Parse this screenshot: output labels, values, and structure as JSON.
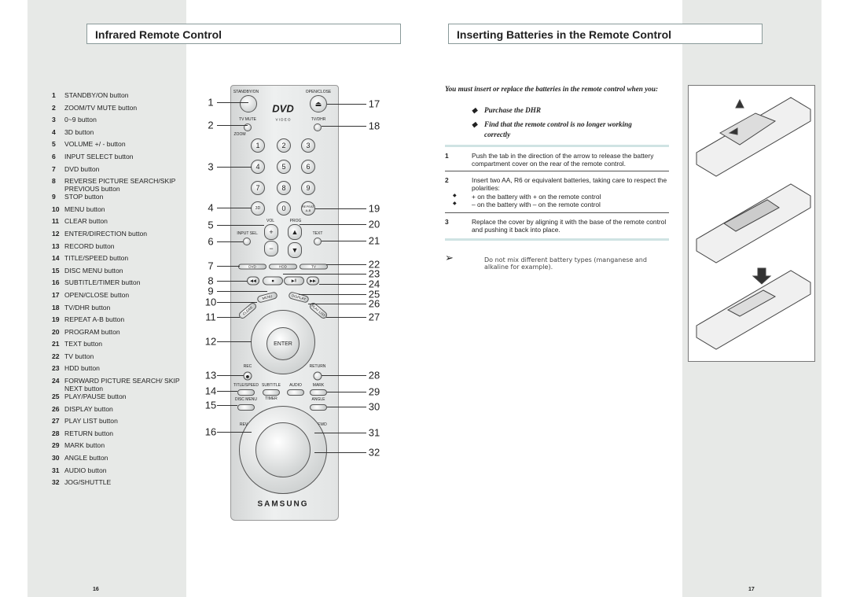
{
  "left_page": {
    "title": "Infrared Remote Control",
    "page_number": "16",
    "items": [
      {
        "n": "1",
        "t": "STANDBY/ON button"
      },
      {
        "n": "2",
        "t": "ZOOM/TV MUTE button"
      },
      {
        "n": "3",
        "t": "0~9 button"
      },
      {
        "n": "4",
        "t": "3D button"
      },
      {
        "n": "5",
        "t": "VOLUME +/ - button"
      },
      {
        "n": "6",
        "t": "INPUT SELECT button"
      },
      {
        "n": "7",
        "t": "DVD button"
      },
      {
        "n": "8",
        "t": "REVERSE PICTURE SEARCH/SKIP PREVIOUS button"
      },
      {
        "n": "9",
        "t": "STOP button"
      },
      {
        "n": "10",
        "t": "MENU button"
      },
      {
        "n": "11",
        "t": "CLEAR button"
      },
      {
        "n": "12",
        "t": "ENTER/DIRECTION button"
      },
      {
        "n": "13",
        "t": "RECORD button"
      },
      {
        "n": "14",
        "t": "TITLE/SPEED button"
      },
      {
        "n": "15",
        "t": "DISC MENU button"
      },
      {
        "n": "16",
        "t": "SUBTITLE/TIMER button"
      },
      {
        "n": "17",
        "t": "OPEN/CLOSE button"
      },
      {
        "n": "18",
        "t": "TV/DHR button"
      },
      {
        "n": "19",
        "t": "REPEAT A-B button"
      },
      {
        "n": "20",
        "t": "PROGRAM button"
      },
      {
        "n": "21",
        "t": "TEXT button"
      },
      {
        "n": "22",
        "t": "TV button"
      },
      {
        "n": "23",
        "t": "HDD button"
      },
      {
        "n": "24",
        "t": "FORWARD PICTURE SEARCH/ SKIP NEXT button"
      },
      {
        "n": "25",
        "t": "PLAY/PAUSE button"
      },
      {
        "n": "26",
        "t": "DISPLAY button"
      },
      {
        "n": "27",
        "t": "PLAY LIST button"
      },
      {
        "n": "28",
        "t": "RETURN button"
      },
      {
        "n": "29",
        "t": "MARK button"
      },
      {
        "n": "30",
        "t": "ANGLE button"
      },
      {
        "n": "31",
        "t": "AUDIO button"
      },
      {
        "n": "32",
        "t": "JOG/SHUTTLE"
      }
    ]
  },
  "remote": {
    "standby": "STANDBY/ON",
    "open_close": "OPEN/CLOSE",
    "dvd_logo": "DVD",
    "video": "V I D E O",
    "tv_mute": "TV MUTE",
    "zoom": "ZOOM",
    "tv_dhr": "TV/DHR",
    "digits": [
      "1",
      "2",
      "3",
      "4",
      "5",
      "6",
      "7",
      "8",
      "9"
    ],
    "three_d": "3D",
    "zero": "0",
    "repeat": "REPEAT A-B",
    "vol": "VOL",
    "prog": "PROG",
    "plus": "+",
    "minus": "−",
    "input_sel": "INPUT SEL.",
    "text": "TEXT",
    "dvd": "DVD",
    "hdd": "HDD",
    "tv": "TV",
    "menu": "MENU",
    "display": "DISPLAY",
    "clear": "CLEAR",
    "play_list": "PLAY LIST",
    "enter": "ENTER",
    "rec": "REC",
    "return": "RETURN",
    "title_speed": "TITLE/SPEED",
    "subtitle": "SUBTITLE",
    "audio": "AUDIO",
    "mark": "MARK",
    "disc_menu": "DISC MENU",
    "timer": "TIMER",
    "angle": "ANGLE",
    "rev": "REV",
    "fwd": "FWD",
    "brand": "SAMSUNG",
    "callouts_left": [
      "1",
      "2",
      "3",
      "4",
      "5",
      "6",
      "7",
      "8",
      "9",
      "10",
      "11",
      "12",
      "13",
      "14",
      "15",
      "16"
    ],
    "callouts_right": [
      "17",
      "18",
      "19",
      "20",
      "21",
      "22",
      "23",
      "24",
      "25",
      "26",
      "27",
      "28",
      "29",
      "30",
      "31",
      "32"
    ]
  },
  "right_page": {
    "title": "Inserting Batteries in the Remote Control",
    "page_number": "17",
    "intro": "You must insert or replace the batteries in the remote control when you:",
    "bullets": [
      "Purchase the DHR",
      "Find that the remote control is no longer working correctly"
    ],
    "steps": [
      {
        "n": "1",
        "t": "Push the tab in the direction of the arrow to release the battery compartment cover on the rear of the remote control."
      },
      {
        "n": "2",
        "t": "Insert two AA, R6 or equivalent batteries, taking care to respect the polarities:",
        "sub": [
          "+ on the battery with + on the remote control",
          "– on the battery with – on the remote control"
        ]
      },
      {
        "n": "3",
        "t": "Replace the cover by aligning it with the base of the remote control and pushing it back into place."
      }
    ],
    "note": "Do not mix different battery types (manganese and alkaline for example)."
  }
}
